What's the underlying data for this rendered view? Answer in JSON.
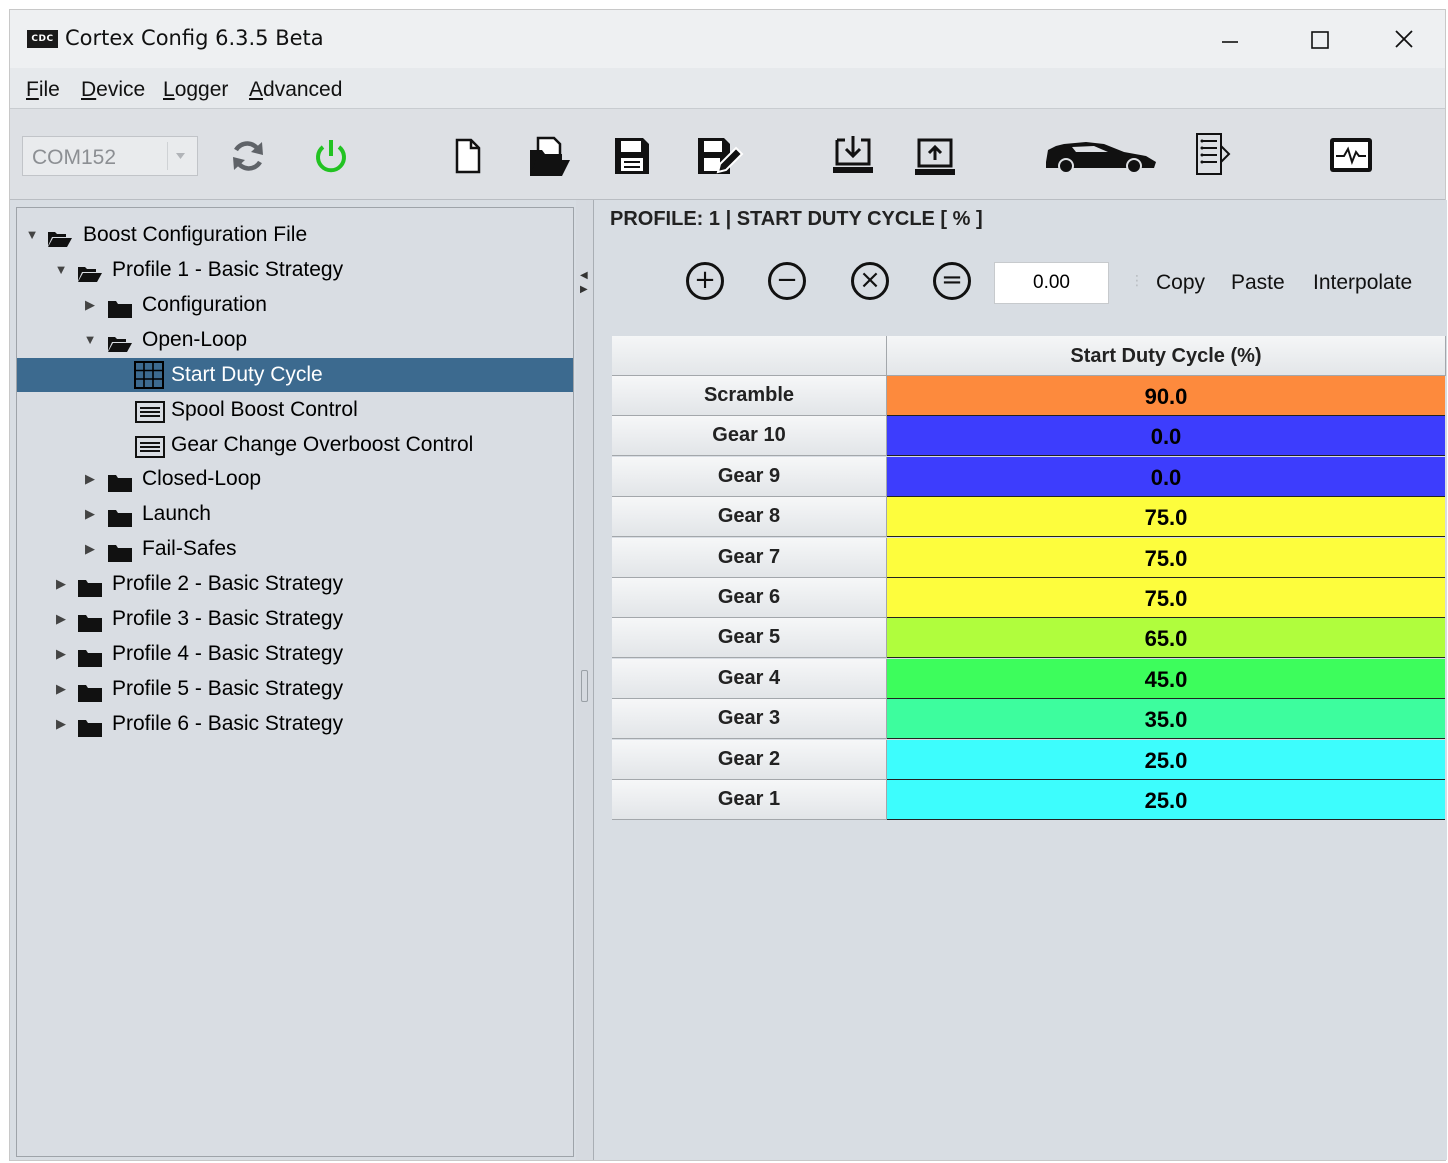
{
  "window": {
    "logo_text": "CDC",
    "title": "Cortex Config 6.3.5 Beta"
  },
  "menu": [
    "File",
    "Device",
    "Logger",
    "Advanced"
  ],
  "toolbar": {
    "port": "COM152",
    "connected_color": "#22c322"
  },
  "tree": {
    "root": "Boost Configuration File",
    "profile1": "Profile 1 - Basic Strategy",
    "configuration": "Configuration",
    "open_loop": "Open-Loop",
    "start_duty_cycle": "Start Duty Cycle",
    "spool_boost_control": "Spool Boost Control",
    "gear_change_overboost": "Gear Change Overboost Control",
    "closed_loop": "Closed-Loop",
    "launch": "Launch",
    "fail_safes": "Fail-Safes",
    "profile2": "Profile 2 - Basic Strategy",
    "profile3": "Profile 3 - Basic Strategy",
    "profile4": "Profile 4 - Basic Strategy",
    "profile5": "Profile 5 - Basic Strategy",
    "profile6": "Profile 6 - Basic Strategy"
  },
  "editor": {
    "title": "PROFILE: 1 | START DUTY CYCLE [ % ]",
    "input_value": "0.00",
    "copy_label": "Copy",
    "paste_label": "Paste",
    "interpolate_label": "Interpolate",
    "add_symbol": "+",
    "subtract_symbol": "−",
    "multiply_symbol": "×",
    "set_symbol": "="
  },
  "table": {
    "column_header": "Start Duty Cycle (%)",
    "rows": [
      {
        "label": "Scramble",
        "value": "90.0",
        "color": "#fd8a3d"
      },
      {
        "label": "Gear 10",
        "value": "0.0",
        "color": "#3d3dfd"
      },
      {
        "label": "Gear 9",
        "value": "0.0",
        "color": "#3d3dfd"
      },
      {
        "label": "Gear 8",
        "value": "75.0",
        "color": "#fdfd3d"
      },
      {
        "label": "Gear 7",
        "value": "75.0",
        "color": "#fdfd3d"
      },
      {
        "label": "Gear 6",
        "value": "75.0",
        "color": "#fdfd3d"
      },
      {
        "label": "Gear 5",
        "value": "65.0",
        "color": "#b0fd3d"
      },
      {
        "label": "Gear 4",
        "value": "45.0",
        "color": "#3dfd5c"
      },
      {
        "label": "Gear 3",
        "value": "35.0",
        "color": "#3dfd9e"
      },
      {
        "label": "Gear 2",
        "value": "25.0",
        "color": "#3dfdfd"
      },
      {
        "label": "Gear 1",
        "value": "25.0",
        "color": "#3dfdfd"
      }
    ]
  },
  "icons": {
    "refresh": "refresh-icon",
    "power": "power-icon",
    "new_file": "new-file-icon",
    "open_file": "open-file-icon",
    "save": "save-icon",
    "save_as": "save-as-icon",
    "download": "download-from-device-icon",
    "upload": "upload-to-device-icon",
    "car": "car-icon",
    "config_list": "config-list-icon",
    "monitor": "monitor-icon"
  }
}
